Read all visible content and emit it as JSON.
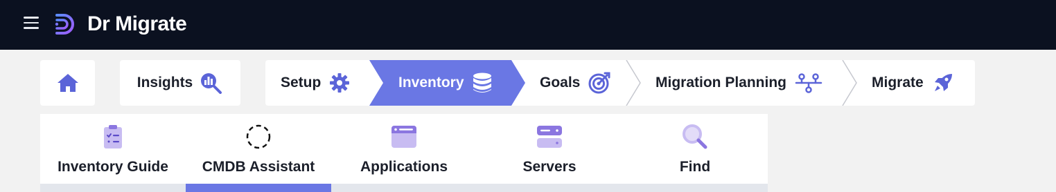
{
  "app": {
    "title": "Dr Migrate"
  },
  "colors": {
    "topbar": "#0b1120",
    "accent": "#6a77e4",
    "icon_accent": "#5b64d8",
    "page_bg": "#f2f2f2"
  },
  "breadcrumb": {
    "home": {
      "icon": "home-icon"
    },
    "steps": [
      {
        "label": "Insights",
        "icon": "chart-search-icon"
      },
      {
        "label": "Setup",
        "icon": "gear-icon"
      },
      {
        "label": "Inventory",
        "icon": "database-icon",
        "active": true
      },
      {
        "label": "Goals",
        "icon": "target-icon"
      },
      {
        "label": "Migration Planning",
        "icon": "network-icon"
      },
      {
        "label": "Migrate",
        "icon": "rocket-icon"
      }
    ]
  },
  "subtabs": [
    {
      "label": "Inventory Guide",
      "icon": "clipboard-checklist-icon"
    },
    {
      "label": "CMDB Assistant",
      "icon": "dashed-circle-icon",
      "active": true
    },
    {
      "label": "Applications",
      "icon": "app-window-icon"
    },
    {
      "label": "Servers",
      "icon": "server-icon"
    },
    {
      "label": "Find",
      "icon": "magnifier-icon"
    }
  ]
}
